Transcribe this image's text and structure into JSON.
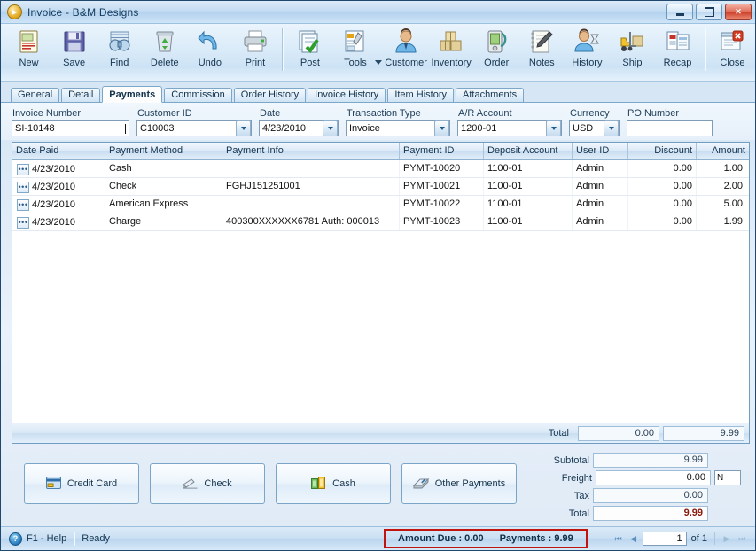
{
  "window": {
    "title": "Invoice - B&M Designs",
    "icon": "play-circle-icon",
    "controls": {
      "minimize": "minimize",
      "maximize": "maximize",
      "close": "close"
    }
  },
  "toolbar": {
    "groups": [
      [
        {
          "label": "New",
          "icon": "new-document-icon"
        },
        {
          "label": "Save",
          "icon": "floppy-disk-icon"
        },
        {
          "label": "Find",
          "icon": "binoculars-icon"
        },
        {
          "label": "Delete",
          "icon": "recycle-bin-icon"
        },
        {
          "label": "Undo",
          "icon": "undo-arrow-icon"
        },
        {
          "label": "Print",
          "icon": "printer-icon"
        }
      ],
      [
        {
          "label": "Post",
          "icon": "post-checkmark-icon"
        },
        {
          "label": "Tools",
          "icon": "tools-wrench-icon",
          "has_dropdown": true
        },
        {
          "label": "Customer",
          "icon": "customer-person-icon"
        },
        {
          "label": "Inventory",
          "icon": "inventory-boxes-icon"
        },
        {
          "label": "Order",
          "icon": "order-device-icon"
        },
        {
          "label": "Notes",
          "icon": "notepad-pencil-icon"
        },
        {
          "label": "History",
          "icon": "history-hourglass-icon"
        },
        {
          "label": "Ship",
          "icon": "forklift-icon"
        },
        {
          "label": "Recap",
          "icon": "recap-report-icon"
        }
      ],
      [
        {
          "label": "Close",
          "icon": "close-window-icon"
        }
      ]
    ]
  },
  "tabs": [
    {
      "label": "General",
      "active": false
    },
    {
      "label": "Detail",
      "active": false
    },
    {
      "label": "Payments",
      "active": true
    },
    {
      "label": "Commission",
      "active": false
    },
    {
      "label": "Order History",
      "active": false
    },
    {
      "label": "Invoice History",
      "active": false
    },
    {
      "label": "Item History",
      "active": false
    },
    {
      "label": "Attachments",
      "active": false
    }
  ],
  "form": {
    "invoice_number": {
      "label": "Invoice Number",
      "value": "SI-10148"
    },
    "customer_id": {
      "label": "Customer ID",
      "value": "C10003"
    },
    "date": {
      "label": "Date",
      "value": "4/23/2010"
    },
    "transaction_type": {
      "label": "Transaction Type",
      "value": "Invoice"
    },
    "ar_account": {
      "label": "A/R Account",
      "value": "1200-01"
    },
    "currency": {
      "label": "Currency",
      "value": "USD"
    },
    "po_number": {
      "label": "PO Number",
      "value": ""
    }
  },
  "grid": {
    "columns": [
      {
        "key": "date_paid",
        "label": "Date Paid",
        "align": "left"
      },
      {
        "key": "payment_method",
        "label": "Payment Method",
        "align": "left"
      },
      {
        "key": "payment_info",
        "label": "Payment Info",
        "align": "left"
      },
      {
        "key": "payment_id",
        "label": "Payment ID",
        "align": "left"
      },
      {
        "key": "deposit_account",
        "label": "Deposit Account",
        "align": "left"
      },
      {
        "key": "user_id",
        "label": "User ID",
        "align": "left"
      },
      {
        "key": "discount",
        "label": "Discount",
        "align": "right"
      },
      {
        "key": "amount",
        "label": "Amount",
        "align": "right"
      }
    ],
    "rows": [
      {
        "date_paid": "4/23/2010",
        "payment_method": "Cash",
        "payment_info": "",
        "payment_id": "PYMT-10020",
        "deposit_account": "1100-01",
        "user_id": "Admin",
        "discount": "0.00",
        "amount": "1.00"
      },
      {
        "date_paid": "4/23/2010",
        "payment_method": "Check",
        "payment_info": "FGHJ151251001",
        "payment_id": "PYMT-10021",
        "deposit_account": "1100-01",
        "user_id": "Admin",
        "discount": "0.00",
        "amount": "2.00"
      },
      {
        "date_paid": "4/23/2010",
        "payment_method": "American Express",
        "payment_info": "",
        "payment_id": "PYMT-10022",
        "deposit_account": "1100-01",
        "user_id": "Admin",
        "discount": "0.00",
        "amount": "5.00"
      },
      {
        "date_paid": "4/23/2010",
        "payment_method": "Charge",
        "payment_info": "400300XXXXXX6781 Auth: 000013",
        "payment_id": "PYMT-10023",
        "deposit_account": "1100-01",
        "user_id": "Admin",
        "discount": "0.00",
        "amount": "1.99"
      }
    ],
    "footer": {
      "label": "Total",
      "discount_total": "0.00",
      "amount_total": "9.99"
    },
    "row_menu_icon": "ellipsis-button-icon"
  },
  "payment_buttons": [
    {
      "label": "Credit Card",
      "icon": "credit-card-icon"
    },
    {
      "label": "Check",
      "icon": "check-writing-icon"
    },
    {
      "label": "Cash",
      "icon": "cash-money-icon"
    },
    {
      "label": "Other Payments",
      "icon": "other-payments-icon"
    }
  ],
  "totals": {
    "subtotal": {
      "label": "Subtotal",
      "value": "9.99"
    },
    "freight": {
      "label": "Freight",
      "value": "0.00",
      "taxable": "N"
    },
    "tax": {
      "label": "Tax",
      "value": "0.00"
    },
    "total": {
      "label": "Total",
      "value": "9.99"
    }
  },
  "statusbar": {
    "help": "F1 - Help",
    "help_icon": "question-mark-icon",
    "state": "Ready",
    "amount_due": "Amount Due : 0.00",
    "payments": "Payments : 9.99",
    "highlight_color": "#c0140e",
    "nav": {
      "first": "first-record-icon",
      "prev": "previous-record-icon",
      "page": "1",
      "of": "of 1",
      "next": "next-record-icon",
      "last": "last-record-icon"
    }
  }
}
